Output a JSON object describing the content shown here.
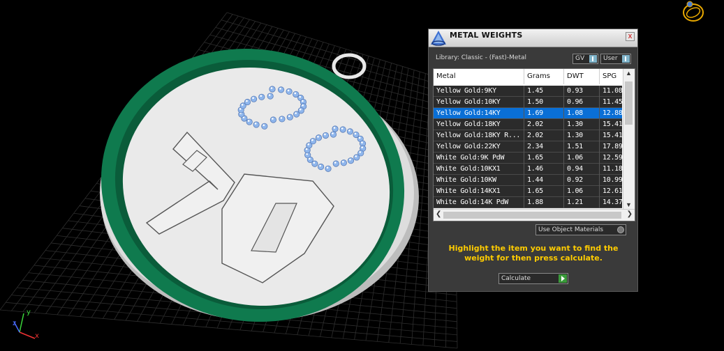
{
  "panel": {
    "title": "METAL WEIGHTS",
    "close_label": "x",
    "library_label": "Library: Classic - (Fast)-Metal",
    "gv_label": "GV",
    "user_label": "User"
  },
  "table": {
    "columns": [
      "Metal",
      "Grams",
      "DWT",
      "SPG"
    ],
    "selected_index": 2,
    "rows": [
      [
        "Yellow Gold:9KY",
        "1.45",
        "0.93",
        "11.08"
      ],
      [
        "Yellow Gold:10KY",
        "1.50",
        "0.96",
        "11.45"
      ],
      [
        "Yellow Gold:14KY",
        "1.69",
        "1.08",
        "12.88"
      ],
      [
        "Yellow Gold:18KY",
        "2.02",
        "1.30",
        "15.41"
      ],
      [
        "Yellow Gold:18KY R...",
        "2.02",
        "1.30",
        "15.41"
      ],
      [
        "Yellow Gold:22KY",
        "2.34",
        "1.51",
        "17.89"
      ],
      [
        "White Gold:9K PdW",
        "1.65",
        "1.06",
        "12.59"
      ],
      [
        "White Gold:10KX1",
        "1.46",
        "0.94",
        "11.18"
      ],
      [
        "White Gold:10KW",
        "1.44",
        "0.92",
        "10.99"
      ],
      [
        "White Gold:14KX1",
        "1.65",
        "1.06",
        "12.61"
      ],
      [
        "White Gold:14K PdW",
        "1.88",
        "1.21",
        "14.37"
      ]
    ]
  },
  "options": {
    "use_object_materials": "Use Object Materials"
  },
  "hint": "Highlight the item you want to find the weight for then press calculate.",
  "calculate_label": "Calculate",
  "axes": {
    "x": "x",
    "y": "y",
    "z": "z"
  },
  "colors": {
    "selection": "#0a6fd6",
    "hint": "#ffcc00",
    "ring": "#0f7a4e",
    "gem": "#8fb6ec"
  }
}
